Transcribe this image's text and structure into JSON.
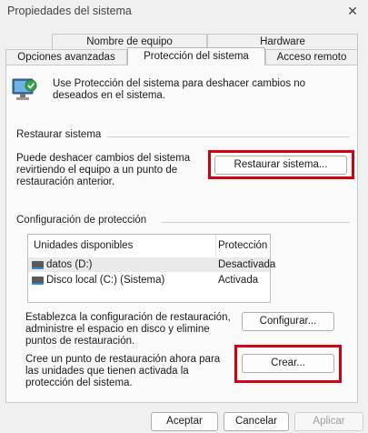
{
  "window": {
    "title": "Propiedades del sistema"
  },
  "tabs": {
    "row1": [
      "Nombre de equipo",
      "Hardware"
    ],
    "row2": [
      "Opciones avanzadas",
      "Protección del sistema",
      "Acceso remoto"
    ],
    "active": "Protección del sistema"
  },
  "intro": {
    "text": "Use Protección del sistema para deshacer cambios no deseados en el sistema."
  },
  "restore": {
    "section_label": "Restaurar sistema",
    "description": "Puede deshacer cambios del sistema revirtiendo el equipo a un punto de restauración anterior.",
    "button_label": "Restaurar sistema..."
  },
  "protection": {
    "section_label": "Configuración de protección",
    "columns": [
      "Unidades disponibles",
      "Protección"
    ],
    "drives": [
      {
        "name": "datos (D:)",
        "status": "Desactivada",
        "icon": "drive-icon"
      },
      {
        "name": "Disco local (C:) (Sistema)",
        "status": "Activada",
        "icon": "system-drive-icon"
      }
    ],
    "configure_text": "Establezca la configuración de restauración, administre el espacio en disco y elimine puntos de restauración.",
    "configure_label": "Configurar...",
    "create_text": "Cree un punto de restauración ahora para las unidades que tienen activada la protección del sistema.",
    "create_label": "Crear..."
  },
  "footer": {
    "ok_label": "Aceptar",
    "cancel_label": "Cancelar",
    "apply_label": "Aplicar"
  },
  "colors": {
    "highlight": "#d00010",
    "accent": "#0067c0"
  }
}
